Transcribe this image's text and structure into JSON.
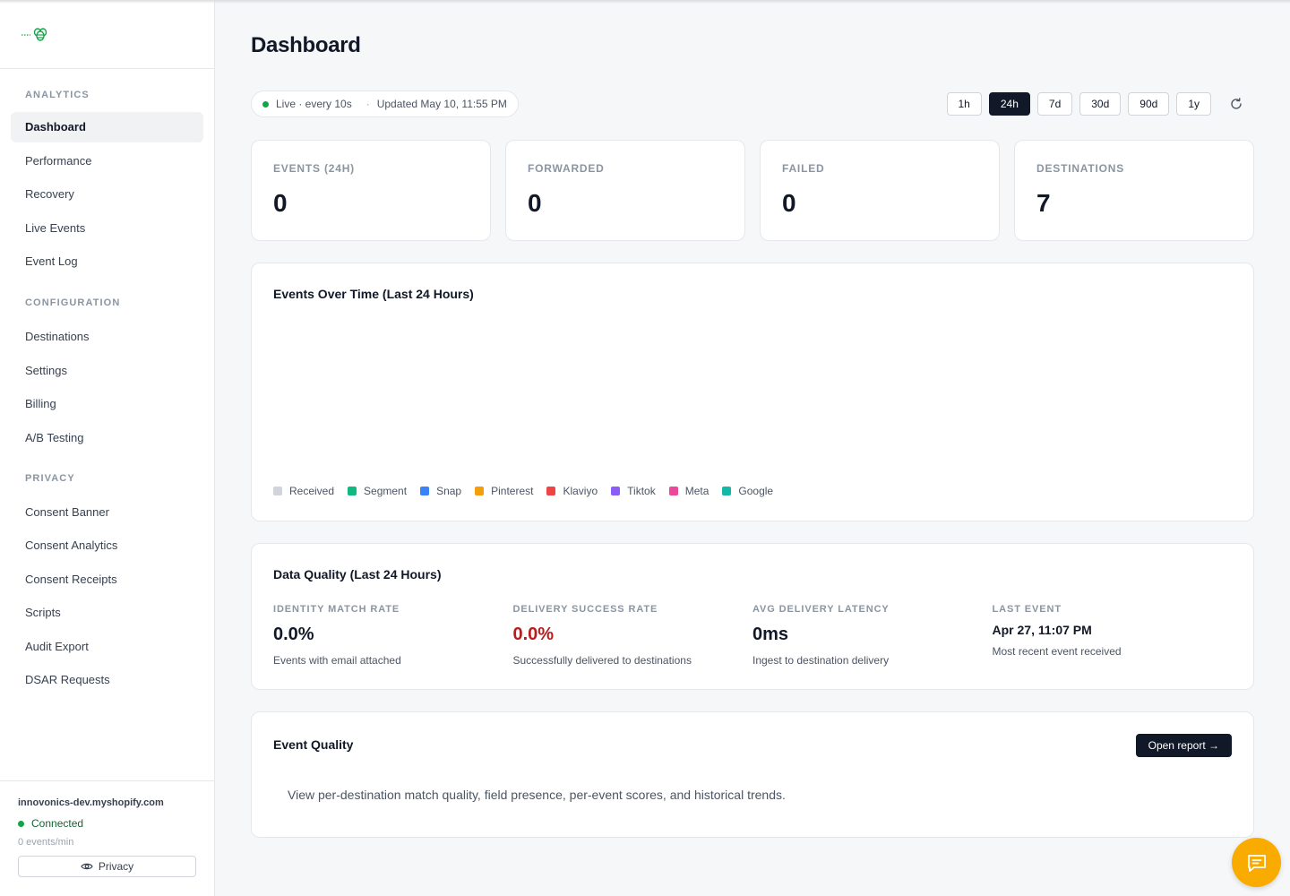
{
  "sidebar": {
    "sections": [
      {
        "title": "ANALYTICS",
        "items": [
          "Dashboard",
          "Performance",
          "Recovery",
          "Live Events",
          "Event Log"
        ]
      },
      {
        "title": "CONFIGURATION",
        "items": [
          "Destinations",
          "Settings",
          "Billing",
          "A/B Testing"
        ]
      },
      {
        "title": "PRIVACY",
        "items": [
          "Consent Banner",
          "Consent Analytics",
          "Consent Receipts",
          "Scripts",
          "Audit Export",
          "DSAR Requests"
        ]
      }
    ],
    "active_item": "Dashboard",
    "store": {
      "domain": "innovonics-dev.myshopify.com",
      "status": "Connected",
      "rate": "0 events/min",
      "privacy_label": "Privacy"
    }
  },
  "header": {
    "title": "Dashboard",
    "live_label": "Live · every 10s",
    "updated_label": "Updated May 10, 11:55 PM",
    "ranges": [
      "1h",
      "24h",
      "7d",
      "30d",
      "90d",
      "1y"
    ],
    "active_range": "24h"
  },
  "stats": [
    {
      "label": "EVENTS (24H)",
      "value": "0"
    },
    {
      "label": "FORWARDED",
      "value": "0"
    },
    {
      "label": "FAILED",
      "value": "0"
    },
    {
      "label": "DESTINATIONS",
      "value": "7"
    }
  ],
  "chart_data": {
    "type": "line",
    "title": "Events Over Time (Last 24 Hours)",
    "x": [],
    "series": [
      {
        "name": "Received",
        "values": [],
        "color": "#d1d5db"
      },
      {
        "name": "Segment",
        "values": [],
        "color": "#10b981"
      },
      {
        "name": "Snap",
        "values": [],
        "color": "#3b82f6"
      },
      {
        "name": "Pinterest",
        "values": [],
        "color": "#f59e0b"
      },
      {
        "name": "Klaviyo",
        "values": [],
        "color": "#ef4444"
      },
      {
        "name": "Tiktok",
        "values": [],
        "color": "#8b5cf6"
      },
      {
        "name": "Meta",
        "values": [],
        "color": "#ec4899"
      },
      {
        "name": "Google",
        "values": [],
        "color": "#14b8a6"
      }
    ],
    "legend": "bottom-left",
    "grid": false
  },
  "data_quality": {
    "title": "Data Quality (Last 24 Hours)",
    "metrics": [
      {
        "label": "IDENTITY MATCH RATE",
        "value": "0.0%",
        "desc": "Events with email attached"
      },
      {
        "label": "DELIVERY SUCCESS RATE",
        "value": "0.0%",
        "desc": "Successfully delivered to destinations"
      },
      {
        "label": "AVG DELIVERY LATENCY",
        "value": "0ms",
        "desc": "Ingest to destination delivery"
      },
      {
        "label": "LAST EVENT",
        "value": "Apr 27, 11:07 PM",
        "desc": "Most recent event received"
      }
    ]
  },
  "event_quality": {
    "title": "Event Quality",
    "button_label": "Open report →",
    "description": "View per-destination match quality, field presence, per-event scores, and historical trends."
  },
  "colors": {
    "accent_dark": "#111827",
    "connected_green": "#16a34a",
    "error_red": "#b91c1c",
    "chat_button": "#f9ab00"
  },
  "icons": {
    "logo": "bee-icon",
    "refresh": "refresh-icon",
    "privacy": "eye-icon",
    "chat": "chat-icon"
  }
}
